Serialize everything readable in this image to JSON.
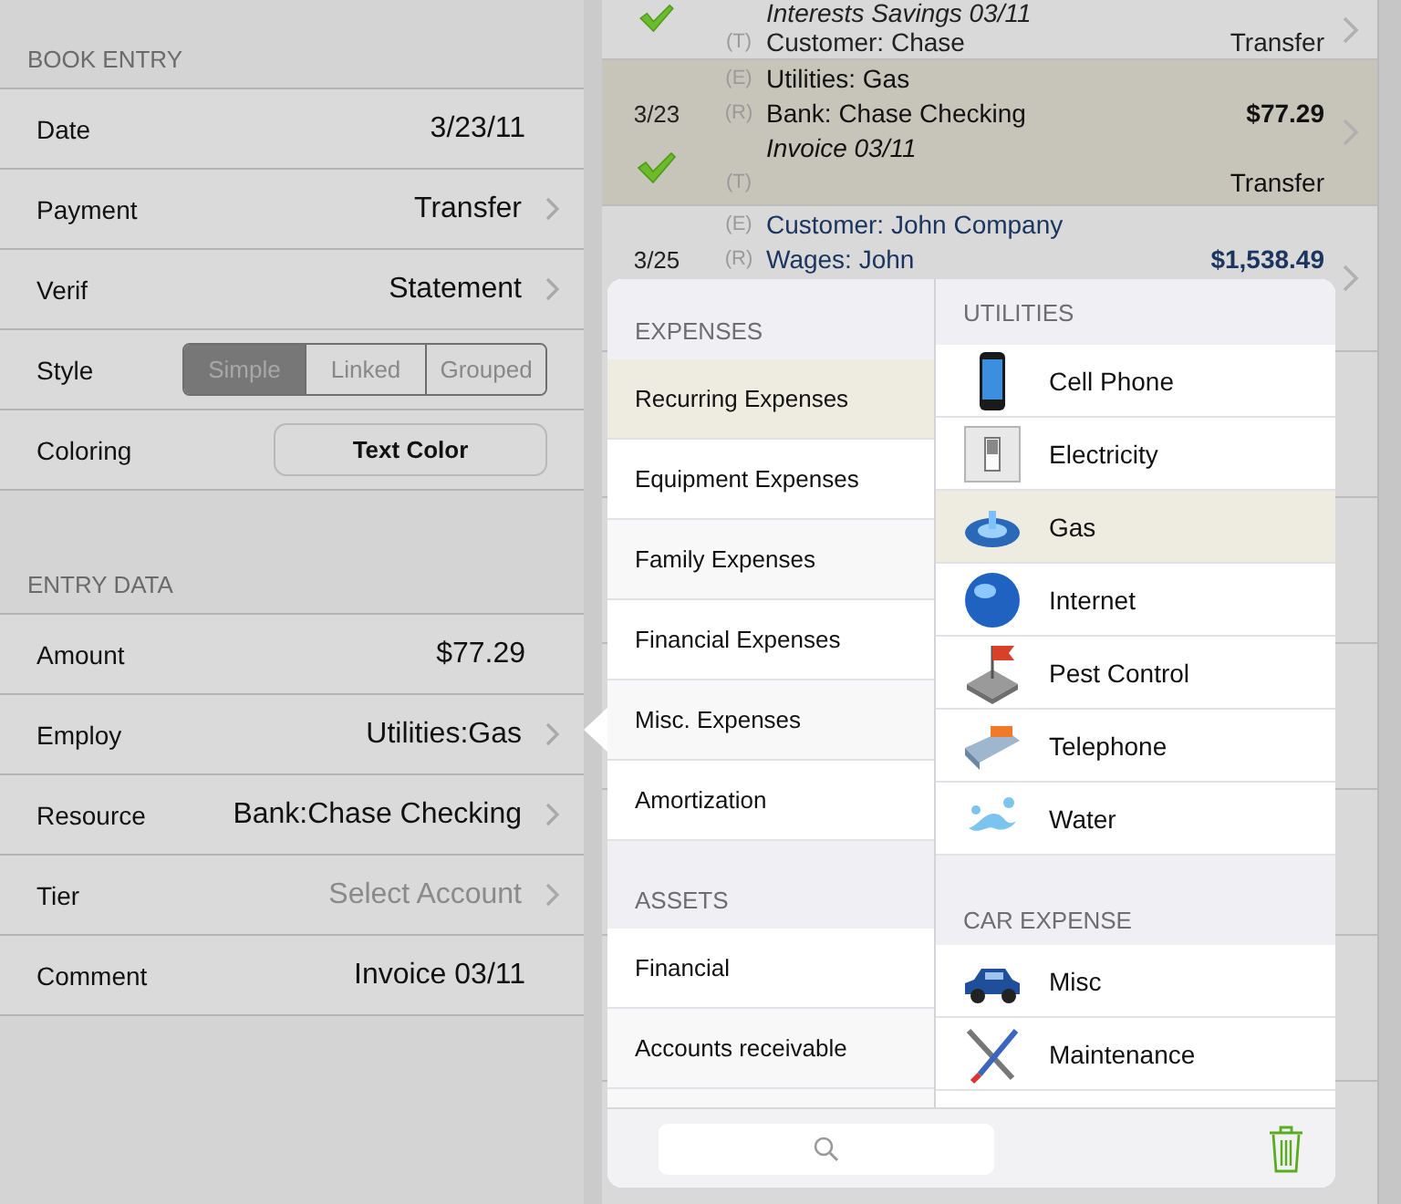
{
  "book_entry": {
    "title": "BOOK ENTRY",
    "rows": [
      {
        "kind": "value",
        "label": "Date",
        "value": "3/23/11"
      },
      {
        "kind": "link",
        "label": "Payment",
        "value": "Transfer"
      },
      {
        "kind": "link",
        "label": "Verif",
        "value": "Statement"
      },
      {
        "kind": "segmented",
        "label": "Style",
        "options": [
          {
            "label": "Simple",
            "selected": true
          },
          {
            "label": "Linked",
            "selected": false
          },
          {
            "label": "Grouped",
            "selected": false
          }
        ]
      },
      {
        "kind": "button",
        "label": "Coloring",
        "button": "Text Color"
      }
    ]
  },
  "entry_data": {
    "title": "ENTRY DATA",
    "rows": [
      {
        "kind": "value",
        "label": "Amount",
        "value": "$77.29"
      },
      {
        "kind": "link",
        "label": "Employ",
        "value": "Utilities:Gas"
      },
      {
        "kind": "link",
        "label": "Resource",
        "value": "Bank:Chase Checking"
      },
      {
        "kind": "link",
        "label": "Tier",
        "placeholder": "Select Account"
      },
      {
        "kind": "value",
        "label": "Comment",
        "value": "Invoice 03/11"
      }
    ]
  },
  "transactions": [
    {
      "verified": true,
      "selected": false,
      "color": "#222222",
      "lines": [
        {
          "text": "Interests Savings 03/11",
          "italic": true
        },
        {
          "tag": "(T)",
          "text": "Customer: Chase",
          "right": "Transfer"
        }
      ]
    },
    {
      "date": "3/23",
      "verified": true,
      "selected": true,
      "color": "#111111",
      "lines": [
        {
          "tag": "(E)",
          "text": "Utilities: Gas"
        },
        {
          "tag": "(R)",
          "text": "Bank: Chase Checking",
          "right": "$77.29",
          "strong": true
        },
        {
          "text": "Invoice 03/11",
          "italic": true
        },
        {
          "tag": "(T)",
          "right": "Transfer"
        }
      ]
    },
    {
      "date": "3/25",
      "selected": false,
      "color": "#1c3560",
      "lines": [
        {
          "tag": "(E)",
          "text": "Customer: John Company"
        },
        {
          "tag": "(R)",
          "text": "Wages: John",
          "right": "$1,538.49",
          "strong": true
        }
      ]
    }
  ],
  "category_picker": {
    "groups": [
      {
        "title": "EXPENSES",
        "items": [
          {
            "label": "Recurring Expenses",
            "selected": true
          },
          {
            "label": "Equipment Expenses",
            "selected": false
          },
          {
            "label": "Family Expenses",
            "selected": false
          },
          {
            "label": "Financial Expenses",
            "selected": false
          },
          {
            "label": "Misc. Expenses",
            "selected": false
          },
          {
            "label": "Amortization",
            "selected": false
          }
        ]
      },
      {
        "title": "ASSETS",
        "items": [
          {
            "label": "Financial",
            "selected": false
          },
          {
            "label": "Accounts receivable",
            "selected": false
          }
        ]
      }
    ],
    "subgroups": [
      {
        "title": "UTILITIES",
        "items": [
          {
            "label": "Cell Phone",
            "selected": false
          },
          {
            "label": "Electricity",
            "selected": false
          },
          {
            "label": "Gas",
            "selected": true
          },
          {
            "label": "Internet",
            "selected": false
          },
          {
            "label": "Pest Control",
            "selected": false
          },
          {
            "label": "Telephone",
            "selected": false
          },
          {
            "label": "Water",
            "selected": false
          }
        ]
      },
      {
        "title": "CAR EXPENSE",
        "items": [
          {
            "label": "Misc",
            "selected": false
          },
          {
            "label": "Maintenance",
            "selected": false
          }
        ]
      }
    ]
  }
}
